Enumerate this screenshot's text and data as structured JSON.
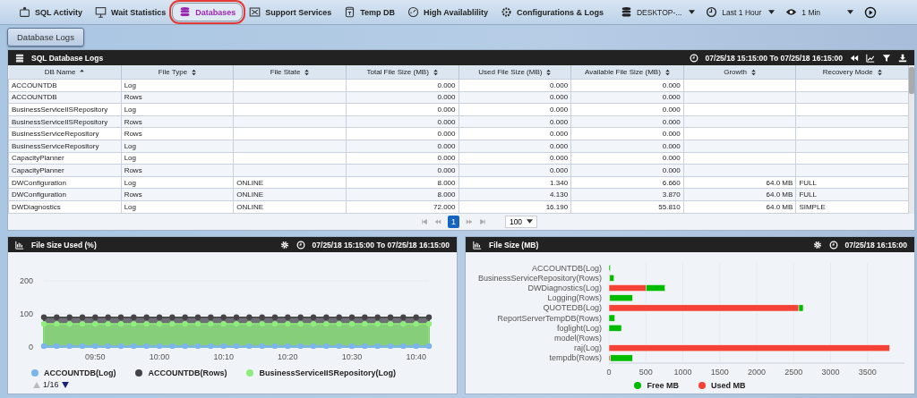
{
  "nav": {
    "items": [
      {
        "label": "SQL Activity",
        "selected": false
      },
      {
        "label": "Wait Statistics",
        "selected": false
      },
      {
        "label": "Databases",
        "selected": true
      },
      {
        "label": "Support Services",
        "selected": false
      },
      {
        "label": "Temp DB",
        "selected": false
      },
      {
        "label": "High Availablility",
        "selected": false
      },
      {
        "label": "Configurations & Logs",
        "selected": false
      }
    ],
    "server": "DESKTOP-...",
    "range": "Last 1 Hour",
    "refresh": "1 Min"
  },
  "subtabs": [
    {
      "label": "Database Logs",
      "selected": true
    }
  ],
  "grid": {
    "title": "SQL Database Logs",
    "range": "07/25/18 15:15:00 To 07/25/18 16:15:00",
    "columns": [
      {
        "label": "DB Name",
        "kind": "text",
        "sorted": true
      },
      {
        "label": "File Type",
        "kind": "text",
        "sorted": false
      },
      {
        "label": "File State",
        "kind": "text",
        "sorted": false
      },
      {
        "label": "Total File Size (MB)",
        "kind": "number",
        "sorted": false
      },
      {
        "label": "Used File Size (MB)",
        "kind": "number",
        "sorted": false
      },
      {
        "label": "Available File Size (MB)",
        "kind": "number",
        "sorted": false
      },
      {
        "label": "Growth",
        "kind": "number",
        "sorted": false
      },
      {
        "label": "Recovery Mode",
        "kind": "text",
        "sorted": false
      }
    ],
    "rows": [
      [
        "ACCOUNTDB",
        "Log",
        null,
        "0.000",
        "0.000",
        "0.000",
        null,
        null
      ],
      [
        "ACCOUNTDB",
        "Rows",
        null,
        "0.000",
        "0.000",
        "0.000",
        null,
        null
      ],
      [
        "BusinessServiceIISRepository",
        "Log",
        null,
        "0.000",
        "0.000",
        "0.000",
        null,
        null
      ],
      [
        "BusinessServiceIISRepository",
        "Rows",
        null,
        "0.000",
        "0.000",
        "0.000",
        null,
        null
      ],
      [
        "BusinessServiceRepository",
        "Rows",
        null,
        "0.000",
        "0.000",
        "0.000",
        null,
        null
      ],
      [
        "BusinessServiceRepository",
        "Log",
        null,
        "0.000",
        "0.000",
        "0.000",
        null,
        null
      ],
      [
        "CapacityPlanner",
        "Log",
        null,
        "0.000",
        "0.000",
        "0.000",
        null,
        null
      ],
      [
        "CapacityPlanner",
        "Rows",
        null,
        "0.000",
        "0.000",
        "0.000",
        null,
        null
      ],
      [
        "DWConfiguration",
        "Log",
        "ONLINE",
        "8.000",
        "1.340",
        "6.660",
        "64.0 MB",
        "FULL"
      ],
      [
        "DWConfiguration",
        "Rows",
        "ONLINE",
        "8.000",
        "4.130",
        "3.870",
        "64.0 MB",
        "FULL"
      ],
      [
        "DWDiagnostics",
        "Log",
        "ONLINE",
        "72.000",
        "16.190",
        "55.810",
        "64.0 MB",
        "SIMPLE"
      ]
    ],
    "pager": {
      "pages": [
        {
          "label": "1",
          "selected": true
        }
      ],
      "page_size": "100"
    }
  },
  "used_panel": {
    "title": "File Size Used (%)",
    "range": "07/25/18 15:15:00 To 07/25/18 16:15:00",
    "chart_data": {
      "type": "area",
      "ylim": [
        0,
        200
      ],
      "yticks": [
        0,
        100,
        200
      ],
      "categories": [
        null,
        null,
        null,
        null,
        "09:50",
        null,
        null,
        null,
        null,
        "10:00",
        null,
        null,
        null,
        null,
        "10:10",
        null,
        null,
        null,
        null,
        "10:20",
        null,
        null,
        null,
        null,
        "10:30",
        null,
        null,
        null,
        null,
        "10:40",
        null
      ],
      "series": [
        {
          "name": "ACCOUNTDB(Log)",
          "color": "#7cb5ec",
          "values": [
            3,
            3,
            3,
            3,
            3,
            3,
            3,
            3,
            3,
            3,
            3,
            3,
            3,
            3,
            3,
            3,
            3,
            3,
            3,
            3,
            3,
            3,
            3,
            3,
            3,
            3,
            3,
            3,
            3,
            3,
            3
          ]
        },
        {
          "name": "ACCOUNTDB(Rows)",
          "color": "#434348",
          "values": [
            90,
            90,
            90,
            90,
            90,
            90,
            90,
            90,
            90,
            90,
            90,
            90,
            90,
            90,
            90,
            90,
            90,
            90,
            90,
            90,
            90,
            90,
            90,
            90,
            90,
            90,
            90,
            90,
            90,
            90,
            90
          ]
        },
        {
          "name": "BusinessServiceIISRepository(Log)",
          "color": "#90ed7d",
          "values": [
            70,
            70,
            70,
            70,
            70,
            70,
            70,
            70,
            70,
            70,
            70,
            70,
            70,
            70,
            70,
            70,
            70,
            70,
            70,
            70,
            70,
            70,
            70,
            70,
            70,
            70,
            70,
            70,
            70,
            70,
            70
          ]
        }
      ]
    },
    "legend_page": "1/16"
  },
  "size_panel": {
    "title": "File Size (MB)",
    "time": "07/25/18 16:15:00",
    "chart_data": {
      "type": "bar",
      "orientation": "horizontal",
      "stacked": true,
      "grid": true,
      "xlim": [
        0,
        4000
      ],
      "xticks": [
        0,
        500,
        1000,
        1500,
        2000,
        2500,
        3000,
        3500
      ],
      "categories": [
        "ACCOUNTDB(Log)",
        "BusinessServiceRepository(Rows)",
        "DWDiagnostics(Log)",
        "Logging(Rows)",
        "QUOTEDB(Log)",
        "ReportServerTempDB(Rows)",
        "foglight(Log)",
        "model(Rows)",
        "raj(Log)",
        "tempdb(Rows)"
      ],
      "series": [
        {
          "name": "Free MB",
          "color": "#00bb00",
          "values": [
            20,
            60,
            260,
            310,
            60,
            80,
            170,
            0,
            0,
            300
          ]
        },
        {
          "name": "Used MB",
          "color": "#f44336",
          "values": [
            0,
            10,
            500,
            10,
            2570,
            0,
            0,
            0,
            3800,
            20
          ]
        }
      ]
    }
  }
}
